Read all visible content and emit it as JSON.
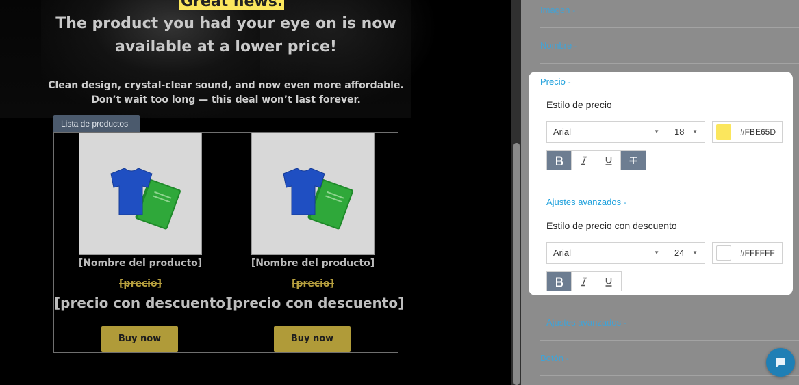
{
  "preview": {
    "highlight": "Great news.",
    "headline": "The product you had your eye on is now available at a lower price!",
    "subtext_line1": "Clean design, crystal-clear sound, and now even more affordable.",
    "subtext_line2": "Don’t wait too long — this deal won’t last forever.",
    "product_list_tab": "Lista de productos",
    "products": [
      {
        "name": "[Nombre del producto]",
        "price": "[precio]",
        "discount_price": "[precio con descuento]",
        "button": "Buy now"
      },
      {
        "name": "[Nombre del producto]",
        "price": "[precio]",
        "discount_price": "[precio con descuento]",
        "button": "Buy now"
      }
    ]
  },
  "panel": {
    "sections": {
      "image": "Imagen",
      "name": "Nombre",
      "price": "Precio",
      "advanced_outer": "Ajustes avanzados",
      "button": "Botón"
    },
    "caret": "-",
    "price_card": {
      "price_style_label": "Estilo de precio",
      "price_font": "Arial",
      "price_size": "18",
      "price_color_hex": "#FBE65D",
      "price_color": "#fbe65d",
      "advanced_inner": "Ajustes avanzados",
      "discount_style_label": "Estilo de precio con descuento",
      "discount_font": "Arial",
      "discount_size": "24",
      "discount_color_hex": "#FFFFFF",
      "discount_color": "#ffffff"
    }
  },
  "colors": {
    "accent": "#1ea0dc",
    "format_active": "#6d7d91",
    "buy_button": "#b09b39"
  }
}
